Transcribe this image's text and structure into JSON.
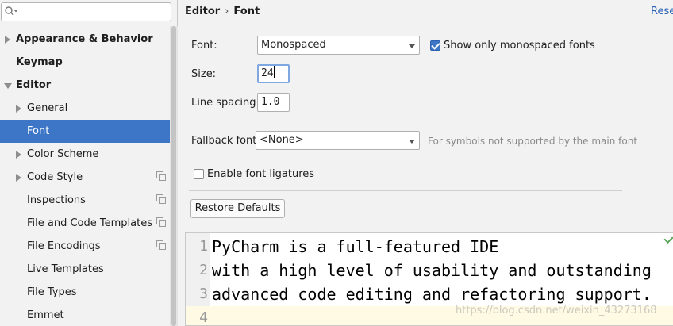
{
  "search": {
    "value": "",
    "placeholder": ""
  },
  "sidebar": {
    "items": [
      {
        "label": "Appearance & Behavior"
      },
      {
        "label": "Keymap"
      },
      {
        "label": "Editor"
      },
      {
        "label": "General"
      },
      {
        "label": "Font"
      },
      {
        "label": "Color Scheme"
      },
      {
        "label": "Code Style"
      },
      {
        "label": "Inspections"
      },
      {
        "label": "File and Code Templates"
      },
      {
        "label": "File Encodings"
      },
      {
        "label": "Live Templates"
      },
      {
        "label": "File Types"
      },
      {
        "label": "Emmet"
      }
    ]
  },
  "breadcrumb": {
    "parent": "Editor",
    "current": "Font",
    "separator": "›"
  },
  "reset_label": "Reset",
  "font": {
    "label": "Font:",
    "value": "Monospaced"
  },
  "monospaced_only": {
    "label": "Show only monospaced fonts",
    "checked": true
  },
  "size": {
    "label": "Size:",
    "value": "24"
  },
  "line_spacing": {
    "label": "Line spacing:",
    "value": "1.0"
  },
  "fallback": {
    "label": "Fallback font:",
    "value": "<None>",
    "hint": "For symbols not supported by the main font"
  },
  "ligatures": {
    "label": "Enable font ligatures",
    "checked": false
  },
  "restore_label": "Restore Defaults",
  "preview": {
    "lines": [
      {
        "num": "1",
        "text": "PyCharm is a full-featured IDE"
      },
      {
        "num": "2",
        "text": "with a high level of usability and outstanding"
      },
      {
        "num": "3",
        "text": "advanced code editing and refactoring support."
      },
      {
        "num": "4",
        "text": ""
      }
    ]
  },
  "watermark": "https://blog.csdn.net/weixin_43273168",
  "colors": {
    "selection": "#3d76c6",
    "link": "#2a62b5",
    "current_line": "#fffae3"
  }
}
